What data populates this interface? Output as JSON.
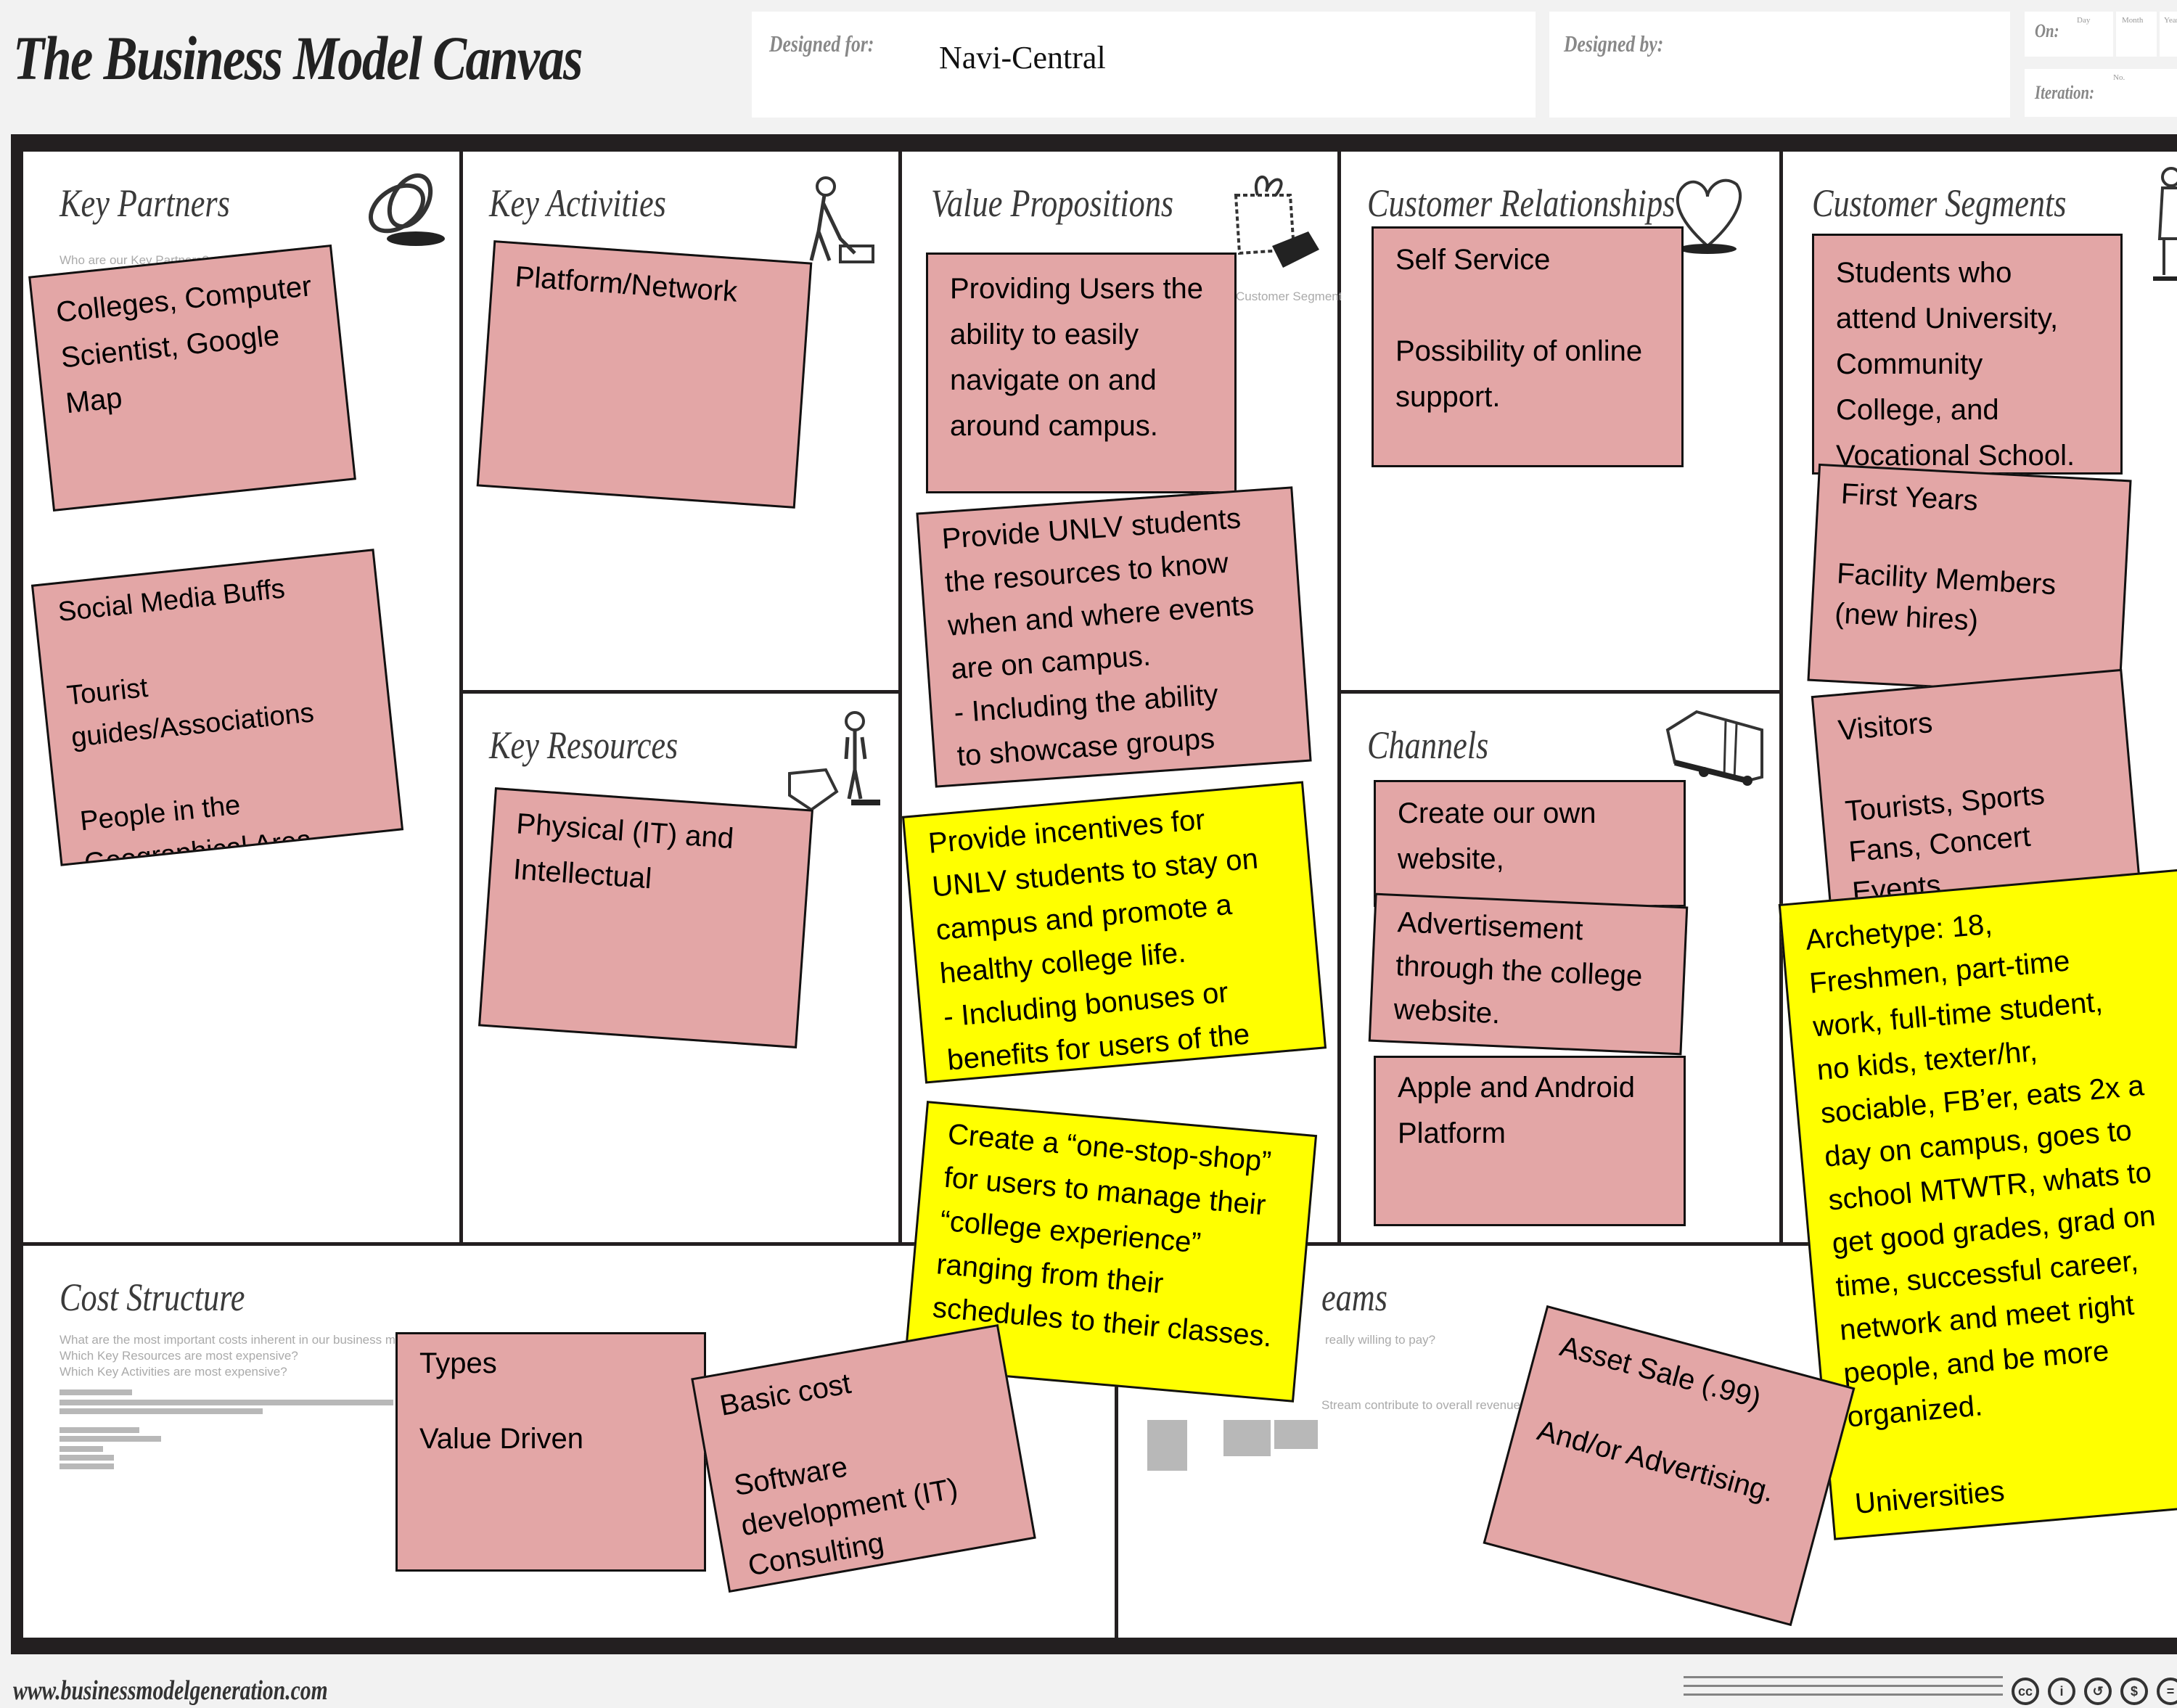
{
  "header": {
    "title": "The Business Model Canvas",
    "designed_for_label": "Designed for:",
    "designed_for_value": "Navi-Central",
    "designed_by_label": "Designed by:",
    "designed_by_value": "",
    "on_label": "On:",
    "on_day": "Day",
    "on_month": "Month",
    "on_year": "Year",
    "iteration_label": "Iteration:",
    "iteration_no": "No."
  },
  "blocks": {
    "key_partners": {
      "title": "Key Partners",
      "hint": "Who are our Key Partners?",
      "icon": "chain-links-icon",
      "notes": [
        {
          "text": "Colleges, Computer\nScientist, Google\nMap",
          "color": "pink"
        },
        {
          "text": "Social Media Buffs\n\nTourist\nguides/Associations\n\nPeople in the\nGeographical Area",
          "color": "pink"
        }
      ]
    },
    "key_activities": {
      "title": "Key Activities",
      "icon": "worker-icon",
      "notes": [
        {
          "text": "Platform/Network",
          "color": "pink"
        }
      ]
    },
    "key_resources": {
      "title": "Key Resources",
      "icon": "forklift-worker-icon",
      "notes": [
        {
          "text": "Physical (IT) and\nIntellectual",
          "color": "pink"
        }
      ]
    },
    "value_propositions": {
      "title": "Value Propositions",
      "hint": "Customer Segment?",
      "icon": "gift-icon",
      "notes": [
        {
          "text": "Providing Users the\nability to easily\nnavigate on and\naround campus.",
          "color": "pink"
        },
        {
          "text": "Provide UNLV students\nthe resources to know\nwhen and where events\nare on campus.\n   - Including the ability\nto showcase groups",
          "color": "pink"
        },
        {
          "text": "Provide incentives for\nUNLV students to stay on\ncampus and promote a\nhealthy college life.\n     - Including bonuses or\nbenefits for users of the",
          "color": "yellow"
        },
        {
          "text": "Create a “one-stop-shop”\nfor users to manage their\n“college experience”\nranging from their\nschedules to their classes.",
          "color": "yellow"
        }
      ]
    },
    "customer_relationships": {
      "title": "Customer Relationships",
      "icon": "heart-icon",
      "notes": [
        {
          "text": "Self Service\n\nPossibility of online\nsupport.",
          "color": "pink"
        }
      ]
    },
    "channels": {
      "title": "Channels",
      "icon": "truck-icon",
      "notes": [
        {
          "text": "Create our own\nwebsite,",
          "color": "pink"
        },
        {
          "text": "Advertisement\nthrough the college\nwebsite.",
          "color": "pink"
        },
        {
          "text": "Apple and Android\nPlatform",
          "color": "pink"
        }
      ]
    },
    "customer_segments": {
      "title": "Customer Segments",
      "icon": "person-icon",
      "notes": [
        {
          "text": "Students who\nattend University,\nCommunity\nCollege, and\nVocational School.",
          "color": "pink"
        },
        {
          "text": "First Years\n\nFacility Members\n(new hires)",
          "color": "pink"
        },
        {
          "text": "Visitors\n\nTourists, Sports\nFans, Concert\nEvents",
          "color": "pink"
        },
        {
          "text": "Archetype: 18,\nFreshmen, part-time\nwork, full-time student,\nno kids, texter/hr,\nsociable, FB’er, eats 2x a\nday on campus, goes to\nschool MTWTR, whats to\nget good grades, grad on\ntime, successful career,\nnetwork and meet right\npeople, and be more\norganized.\n\nUniversities",
          "color": "yellow"
        }
      ]
    },
    "cost_structure": {
      "title": "Cost Structure",
      "hints": [
        "What are the most important costs inherent in our business model?",
        "Which Key Resources are most expensive?",
        "Which Key Activities are most expensive?"
      ],
      "notes": [
        {
          "text": "Types\n\nValue Driven",
          "color": "pink"
        },
        {
          "text": "Basic cost\n\nSoftware\ndevelopment (IT)\nConsulting",
          "color": "pink"
        }
      ]
    },
    "revenue_streams": {
      "title": "Revenue Streams",
      "visible_title": "eams",
      "hints": [
        "really willing to pay?",
        "Stream contribute to overall revenues?"
      ],
      "notes": [
        {
          "text": "Asset Sale (.99)\n\nAnd/or Advertising.",
          "color": "pink"
        }
      ]
    }
  },
  "footer": {
    "url": "www.businessmodelgeneration.com",
    "license_icons": [
      "cc-icon",
      "by-icon",
      "sa-icon",
      "nc-icon"
    ]
  },
  "colors": {
    "pink_note": "#e3a6a6",
    "yellow_note": "#ffff00",
    "frame": "#231f20",
    "background": "#f2f2f2"
  }
}
